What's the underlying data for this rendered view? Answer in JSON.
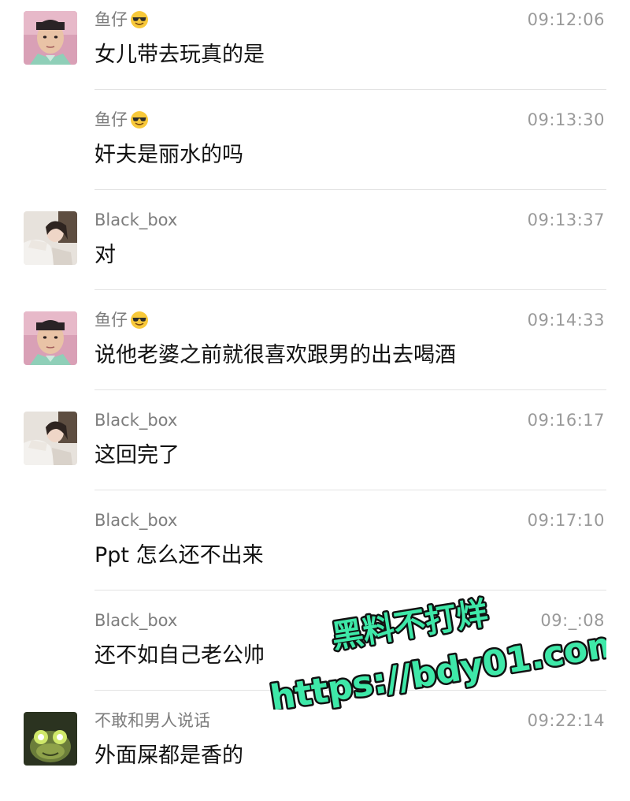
{
  "messages": [
    {
      "sender": "鱼仔",
      "has_emoji": true,
      "emoji_icon": "sunglasses-face-icon",
      "time": "09:12:06",
      "text": "女儿带去玩真的是",
      "avatar": "boy"
    },
    {
      "sender": "鱼仔",
      "has_emoji": true,
      "emoji_icon": "sunglasses-face-icon",
      "time": "09:13:30",
      "text": "奸夫是丽水的吗",
      "avatar": null
    },
    {
      "sender": "Black_box",
      "has_emoji": false,
      "time": "09:13:37",
      "text": "对",
      "avatar": "girl"
    },
    {
      "sender": "鱼仔",
      "has_emoji": true,
      "emoji_icon": "sunglasses-face-icon",
      "time": "09:14:33",
      "text": "说他老婆之前就很喜欢跟男的出去喝酒",
      "avatar": "boy"
    },
    {
      "sender": "Black_box",
      "has_emoji": false,
      "time": "09:16:17",
      "text": "这回完了",
      "avatar": "girl"
    },
    {
      "sender": "Black_box",
      "has_emoji": false,
      "time": "09:17:10",
      "text": "Ppt 怎么还不出来",
      "avatar": null
    },
    {
      "sender": "Black_box",
      "has_emoji": false,
      "time": "09:_:08",
      "text": "还不如自己老公帅",
      "avatar": null
    },
    {
      "sender": "不敢和男人说话",
      "has_emoji": false,
      "time": "09:22:14",
      "text": "外面屎都是香的",
      "avatar": "frog"
    }
  ],
  "watermark": {
    "line1": "黑料不打烊",
    "line2": "https://bdy01.com",
    "fill_color": "#3ee8a8",
    "stroke_color": "#111111"
  },
  "colors": {
    "sender": "#7d7d7d",
    "time": "#9a9a9a",
    "text": "#111111",
    "divider": "#e3e3e3"
  }
}
